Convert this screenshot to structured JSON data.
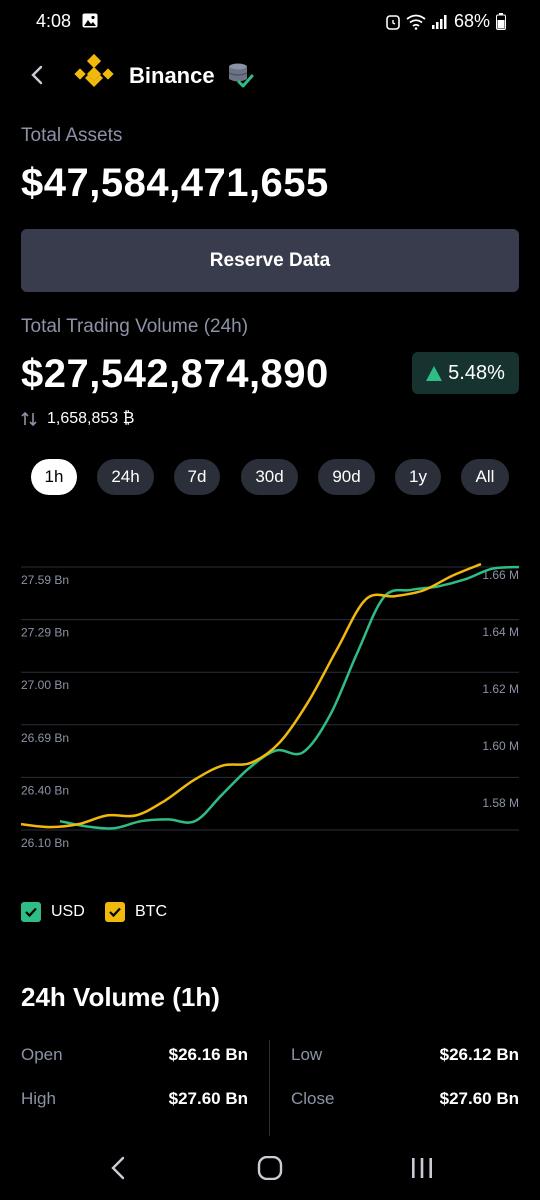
{
  "status_bar": {
    "time": "4:08",
    "battery": "68%",
    "icons": [
      "gallery-icon",
      "alarm-icon",
      "wifi-icon",
      "signal-icon",
      "battery-icon"
    ]
  },
  "header": {
    "title": "Binance",
    "icons": [
      "back-icon",
      "binance-logo-icon",
      "database-verified-icon"
    ]
  },
  "assets": {
    "label": "Total Assets",
    "value": "$47,584,471,655"
  },
  "reserve_button": "Reserve Data",
  "volume": {
    "label": "Total Trading Volume (24h)",
    "value": "$27,542,874,890",
    "change": "5.48%",
    "btc_amount": "1,658,853 ₿"
  },
  "time_tabs": [
    {
      "label": "1h",
      "active": true
    },
    {
      "label": "24h",
      "active": false
    },
    {
      "label": "7d",
      "active": false
    },
    {
      "label": "30d",
      "active": false
    },
    {
      "label": "90d",
      "active": false
    },
    {
      "label": "1y",
      "active": false
    },
    {
      "label": "All",
      "active": false
    }
  ],
  "chart_data": {
    "type": "line",
    "y_left_ticks": [
      "27.59 Bn",
      "27.29 Bn",
      "27.00 Bn",
      "26.69 Bn",
      "26.40 Bn",
      "26.10 Bn"
    ],
    "y_right_ticks": [
      "1.66 M",
      "1.64 M",
      "1.62 M",
      "1.60 M",
      "1.58 M"
    ],
    "y_left_range": [
      26.1,
      27.59
    ],
    "y_right_range": [
      1.57,
      1.66
    ],
    "x": [
      0,
      1,
      2,
      3,
      4,
      5,
      6,
      7,
      8,
      9,
      10,
      11,
      12,
      13,
      14,
      15,
      16,
      17,
      18,
      19,
      20
    ],
    "grid": true,
    "legend_position": "bottom-left",
    "series": [
      {
        "name": "USD",
        "color": "#2ebd85",
        "axis": "left",
        "values": [
          26.15,
          26.12,
          26.11,
          26.15,
          26.16,
          26.15,
          26.3,
          26.45,
          26.55,
          26.54,
          26.75,
          27.1,
          27.42,
          27.46,
          27.48,
          27.52,
          27.58,
          27.59
        ]
      },
      {
        "name": "BTC",
        "color": "#f0b90b",
        "axis": "right",
        "values": [
          1.572,
          1.571,
          1.572,
          1.575,
          1.575,
          1.58,
          1.587,
          1.592,
          1.593,
          1.6,
          1.614,
          1.632,
          1.649,
          1.65,
          1.652,
          1.657,
          1.661
        ]
      }
    ]
  },
  "legend": [
    {
      "label": "USD",
      "color": "#2ebd85"
    },
    {
      "label": "BTC",
      "color": "#f0b90b"
    }
  ],
  "volume_section": {
    "title": "24h Volume (1h)",
    "left": [
      {
        "label": "Open",
        "value": "$26.16 Bn"
      },
      {
        "label": "High",
        "value": "$27.60 Bn"
      }
    ],
    "right": [
      {
        "label": "Low",
        "value": "$26.12 Bn"
      },
      {
        "label": "Close",
        "value": "$27.60 Bn"
      }
    ]
  },
  "nav_bar": [
    "recent-apps-icon",
    "home-icon",
    "back-nav-icon"
  ]
}
